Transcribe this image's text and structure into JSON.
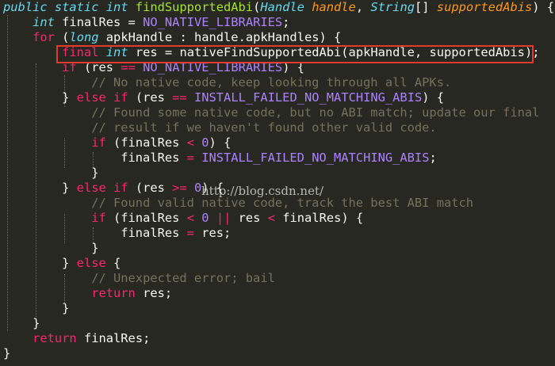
{
  "editor": {
    "colors": {
      "background": "#272822",
      "highlight_box": "#e23b2e"
    },
    "watermark": "http://blog.csdn.net/",
    "lines": [
      [
        [
          "storage",
          "public static int "
        ],
        [
          "func",
          "findSupportedAbi"
        ],
        [
          "plain",
          "("
        ],
        [
          "storage",
          "Handle "
        ],
        [
          "param",
          "handle"
        ],
        [
          "plain",
          ", "
        ],
        [
          "storage",
          "String"
        ],
        [
          "plain",
          "[] "
        ],
        [
          "param",
          "supportedAbis"
        ],
        [
          "plain",
          ") {"
        ]
      ],
      [
        [
          "plain",
          "    "
        ],
        [
          "storage",
          "int"
        ],
        [
          "plain",
          " finalRes = "
        ],
        [
          "const",
          "NO_NATIVE_LIBRARIES"
        ],
        [
          "plain",
          ";"
        ]
      ],
      [
        [
          "plain",
          "    "
        ],
        [
          "keyword",
          "for"
        ],
        [
          "plain",
          " ("
        ],
        [
          "storage",
          "long"
        ],
        [
          "plain",
          " apkHandle : handle.apkHandles) {"
        ]
      ],
      [
        [
          "plain",
          "        "
        ],
        [
          "keyword",
          "final"
        ],
        [
          "plain",
          " "
        ],
        [
          "storage",
          "int"
        ],
        [
          "plain",
          " res = nativeFindSupportedAbi(apkHandle, supportedAbis);"
        ]
      ],
      [
        [
          "plain",
          "        "
        ],
        [
          "keyword",
          "if"
        ],
        [
          "plain",
          " (res "
        ],
        [
          "keyword",
          "=="
        ],
        [
          "plain",
          " "
        ],
        [
          "const",
          "NO_NATIVE_LIBRARIES"
        ],
        [
          "plain",
          ") {"
        ]
      ],
      [
        [
          "plain",
          "            "
        ],
        [
          "comment",
          "// No native code, keep looking through all APKs."
        ]
      ],
      [
        [
          "plain",
          "        } "
        ],
        [
          "keyword",
          "else if"
        ],
        [
          "plain",
          " (res "
        ],
        [
          "keyword",
          "=="
        ],
        [
          "plain",
          " "
        ],
        [
          "const",
          "INSTALL_FAILED_NO_MATCHING_ABIS"
        ],
        [
          "plain",
          ") {"
        ]
      ],
      [
        [
          "plain",
          "            "
        ],
        [
          "comment",
          "// Found some native code, but no ABI match; update our final"
        ]
      ],
      [
        [
          "plain",
          "            "
        ],
        [
          "comment",
          "// result if we haven't found other valid code."
        ]
      ],
      [
        [
          "plain",
          "            "
        ],
        [
          "keyword",
          "if"
        ],
        [
          "plain",
          " (finalRes "
        ],
        [
          "keyword",
          "<"
        ],
        [
          "plain",
          " "
        ],
        [
          "const",
          "0"
        ],
        [
          "plain",
          ") {"
        ]
      ],
      [
        [
          "plain",
          "                finalRes "
        ],
        [
          "keyword",
          "="
        ],
        [
          "plain",
          " "
        ],
        [
          "const",
          "INSTALL_FAILED_NO_MATCHING_ABIS"
        ],
        [
          "plain",
          ";"
        ]
      ],
      [
        [
          "plain",
          "            }"
        ]
      ],
      [
        [
          "plain",
          "        } "
        ],
        [
          "keyword",
          "else if"
        ],
        [
          "plain",
          " (res "
        ],
        [
          "keyword",
          ">="
        ],
        [
          "plain",
          " "
        ],
        [
          "const",
          "0"
        ],
        [
          "plain",
          ") {"
        ]
      ],
      [
        [
          "plain",
          "            "
        ],
        [
          "comment",
          "// Found valid native code, track the best ABI match"
        ]
      ],
      [
        [
          "plain",
          "            "
        ],
        [
          "keyword",
          "if"
        ],
        [
          "plain",
          " (finalRes "
        ],
        [
          "keyword",
          "<"
        ],
        [
          "plain",
          " "
        ],
        [
          "const",
          "0"
        ],
        [
          "plain",
          " "
        ],
        [
          "keyword",
          "||"
        ],
        [
          "plain",
          " res "
        ],
        [
          "keyword",
          "<"
        ],
        [
          "plain",
          " finalRes) {"
        ]
      ],
      [
        [
          "plain",
          "                finalRes "
        ],
        [
          "keyword",
          "="
        ],
        [
          "plain",
          " res;"
        ]
      ],
      [
        [
          "plain",
          "            }"
        ]
      ],
      [
        [
          "plain",
          "        } "
        ],
        [
          "keyword",
          "else"
        ],
        [
          "plain",
          " {"
        ]
      ],
      [
        [
          "plain",
          "            "
        ],
        [
          "comment",
          "// Unexpected error; bail"
        ]
      ],
      [
        [
          "plain",
          "            "
        ],
        [
          "keyword",
          "return"
        ],
        [
          "plain",
          " res;"
        ]
      ],
      [
        [
          "plain",
          "        }"
        ]
      ],
      [
        [
          "plain",
          "    }"
        ]
      ],
      [
        [
          "plain",
          "    "
        ],
        [
          "keyword",
          "return"
        ],
        [
          "plain",
          " finalRes;"
        ]
      ],
      [
        [
          "plain",
          "}"
        ]
      ]
    ]
  }
}
